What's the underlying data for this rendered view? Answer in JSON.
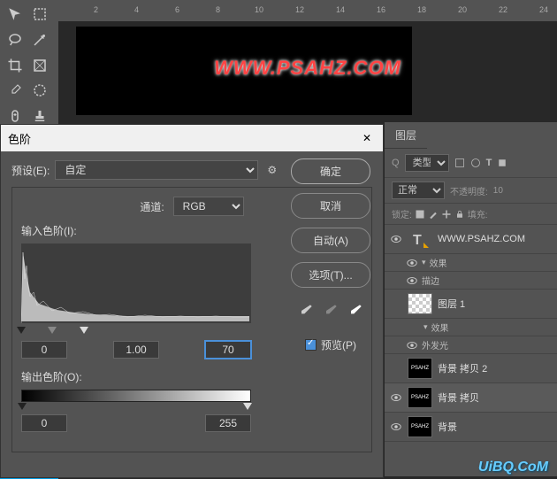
{
  "ruler": {
    "ticks": [
      2,
      4,
      6,
      8,
      10,
      12,
      14,
      16,
      18,
      20,
      22,
      24
    ]
  },
  "canvas": {
    "text": "WWW.PSAHZ.COM"
  },
  "dialog": {
    "title": "色阶",
    "preset_label": "预设(E):",
    "preset_value": "自定",
    "channel_label": "通道:",
    "channel_value": "RGB",
    "input_levels_label": "输入色阶(I):",
    "output_levels_label": "输出色阶(O):",
    "input_values": {
      "black": "0",
      "gamma": "1.00",
      "white": "70"
    },
    "output_values": {
      "black": "0",
      "white": "255"
    },
    "buttons": {
      "ok": "确定",
      "cancel": "取消",
      "auto": "自动(A)",
      "options": "选项(T)..."
    },
    "preview_label": "预览(P)"
  },
  "layers": {
    "tab": "图层",
    "search_placeholder": "类型",
    "blend_mode": "正常",
    "opacity_label": "不透明度:",
    "opacity_value": "10",
    "lock_label": "锁定:",
    "fill_label": "填充:",
    "items": [
      {
        "name": "WWW.PSAHZ.COM",
        "type": "text",
        "visible": true,
        "effects_label": "效果",
        "sub_effects": [
          "描边"
        ]
      },
      {
        "name": "图层 1",
        "type": "checker",
        "visible": false,
        "effects_label": "效果",
        "sub_effects": [
          "外发光"
        ]
      },
      {
        "name": "背景 拷贝 2",
        "type": "psahz",
        "visible": false
      },
      {
        "name": "背景 拷贝",
        "type": "psahz",
        "visible": true
      },
      {
        "name": "背景",
        "type": "psahz",
        "visible": true
      }
    ]
  },
  "watermark": "UiBQ.CoM"
}
